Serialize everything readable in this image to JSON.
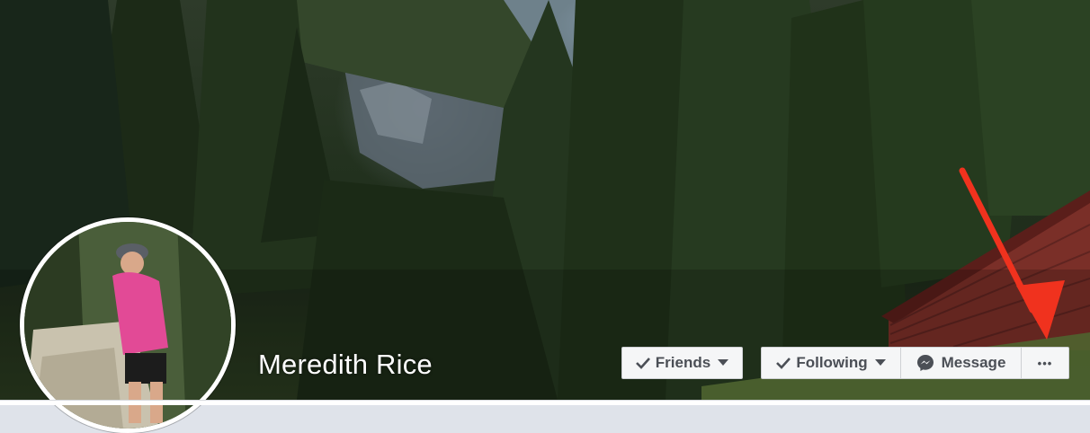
{
  "profile": {
    "name": "Meredith Rice"
  },
  "actions": {
    "friends_label": "Friends",
    "following_label": "Following",
    "message_label": "Message",
    "more_label": "•••"
  },
  "icons": {
    "friends": "checkmark-icon",
    "following": "checkmark-icon",
    "message": "messenger-icon",
    "dropdown": "caret-down-icon"
  },
  "colors": {
    "button_bg": "#f5f6f7",
    "button_text": "#4b4f56",
    "annotation_arrow": "#f0321e"
  }
}
